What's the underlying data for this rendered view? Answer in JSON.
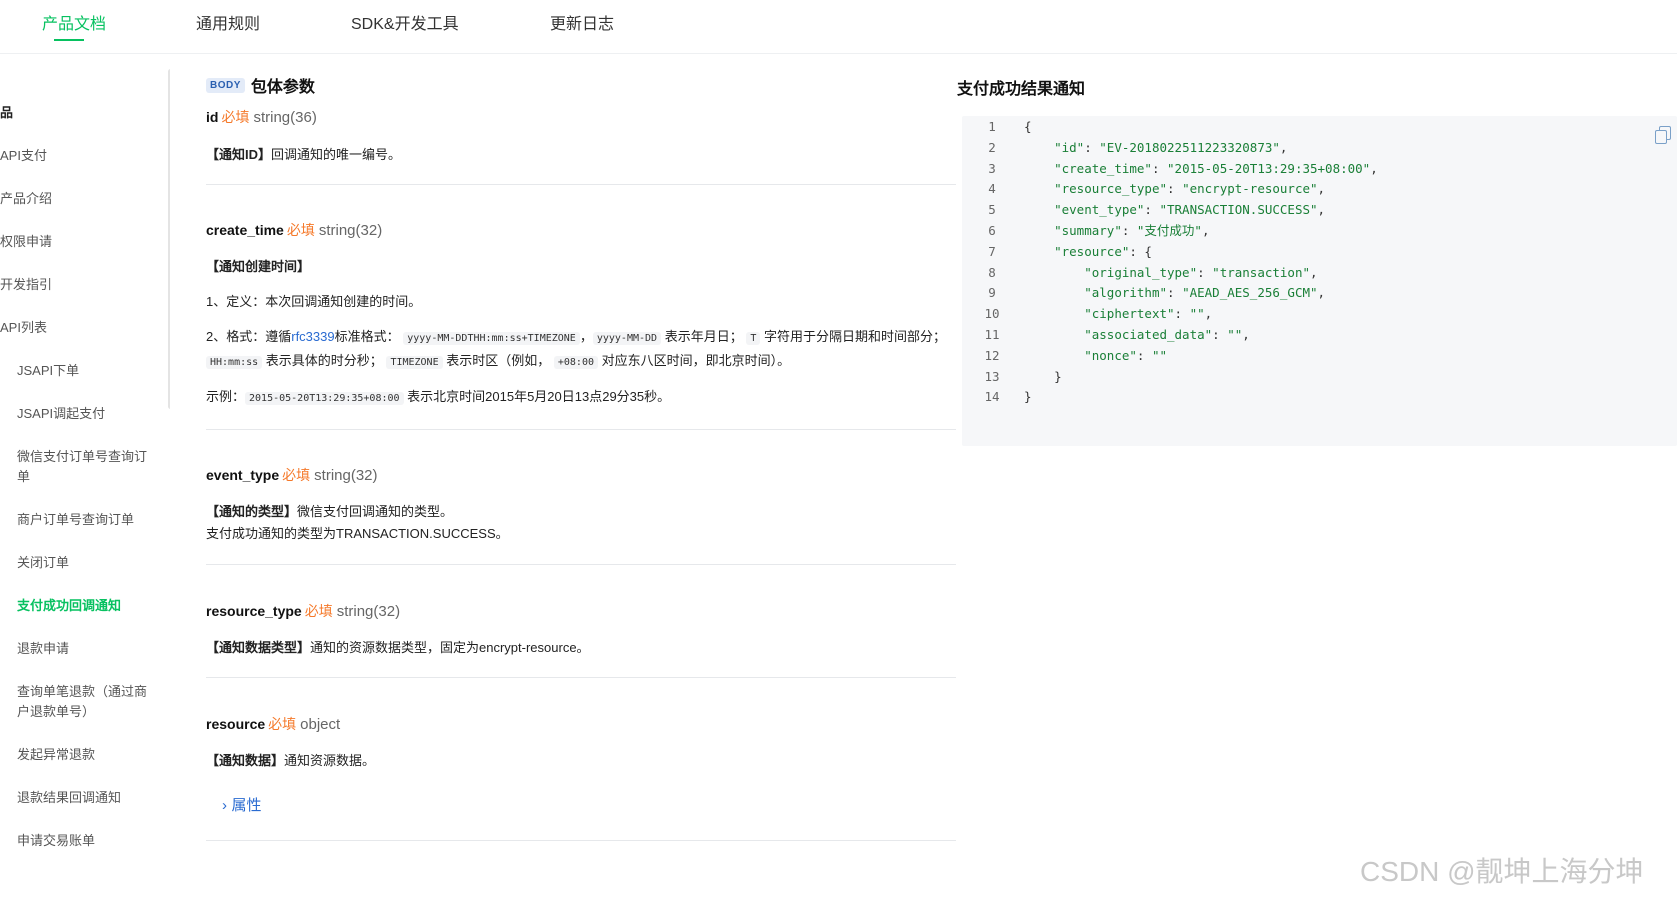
{
  "topnav": {
    "tabs": [
      "产品文档",
      "通用规则",
      "SDK&开发工具",
      "更新日志"
    ]
  },
  "sidebar": {
    "items": [
      "品",
      "API支付",
      "产品介绍",
      "权限申请",
      "开发指引",
      "API列表",
      "JSAPI下单",
      "JSAPI调起支付",
      "微信支付订单号查询订单",
      "商户订单号查询订单",
      "关闭订单",
      "支付成功回调通知",
      "退款申请",
      "查询单笔退款（通过商户退款单号）",
      "发起异常退款",
      "退款结果回调通知",
      "申请交易账单"
    ]
  },
  "doc": {
    "badge": "BODY",
    "section_title": "包体参数",
    "required_label": "必填",
    "fields": {
      "id": {
        "name": "id",
        "type": "string(36)",
        "desc_bold": "【通知ID】",
        "desc": "回调通知的唯一编号。"
      },
      "create_time": {
        "name": "create_time",
        "type": "string(32)",
        "desc_bold": "【通知创建时间】",
        "line1": "1、定义：本次回调通知创建的时间。",
        "line2_a": "2、格式：遵循",
        "line2_link": "rfc3339",
        "line2_b": "标准格式：",
        "code1": "yyyy-MM-DDTHH:mm:ss+TIMEZONE",
        "sep1": "，",
        "code2": "yyyy-MM-DD",
        "line2_c": "表示年月日；",
        "code3": "T",
        "line2_d": "字符用于分隔日期和时间部分；",
        "code4": "HH:mm:ss",
        "line2_e": "表示具体的时分秒；",
        "code5": "TIMEZONE",
        "line2_f": "表示时区（例如，",
        "code6": "+08:00",
        "line2_g": "对应东八区时间，即北京时间）。",
        "example_label": "示例：",
        "example_code": "2015-05-20T13:29:35+08:00",
        "example_text": "表示北京时间2015年5月20日13点29分35秒。"
      },
      "event_type": {
        "name": "event_type",
        "type": "string(32)",
        "desc_bold": "【通知的类型】",
        "desc": "微信支付回调通知的类型。",
        "desc2": "支付成功通知的类型为TRANSACTION.SUCCESS。"
      },
      "resource_type": {
        "name": "resource_type",
        "type": "string(32)",
        "desc_bold": "【通知数据类型】",
        "desc": "通知的资源数据类型，固定为encrypt-resource。"
      },
      "resource": {
        "name": "resource",
        "type": "object",
        "desc_bold": "【通知数据】",
        "desc": "通知资源数据。",
        "props_label": "属性"
      }
    }
  },
  "right": {
    "title": "支付成功结果通知",
    "code_lines": [
      "{",
      "    \"id\": \"EV-2018022511223320873\",",
      "    \"create_time\": \"2015-05-20T13:29:35+08:00\",",
      "    \"resource_type\": \"encrypt-resource\",",
      "    \"event_type\": \"TRANSACTION.SUCCESS\",",
      "    \"summary\": \"支付成功\",",
      "    \"resource\": {",
      "        \"original_type\": \"transaction\",",
      "        \"algorithm\": \"AEAD_AES_256_GCM\",",
      "        \"ciphertext\": \"\",",
      "        \"associated_data\": \"\",",
      "        \"nonce\": \"\"",
      "    }",
      "}"
    ]
  },
  "watermark": "CSDN @靓坤上海分坤"
}
